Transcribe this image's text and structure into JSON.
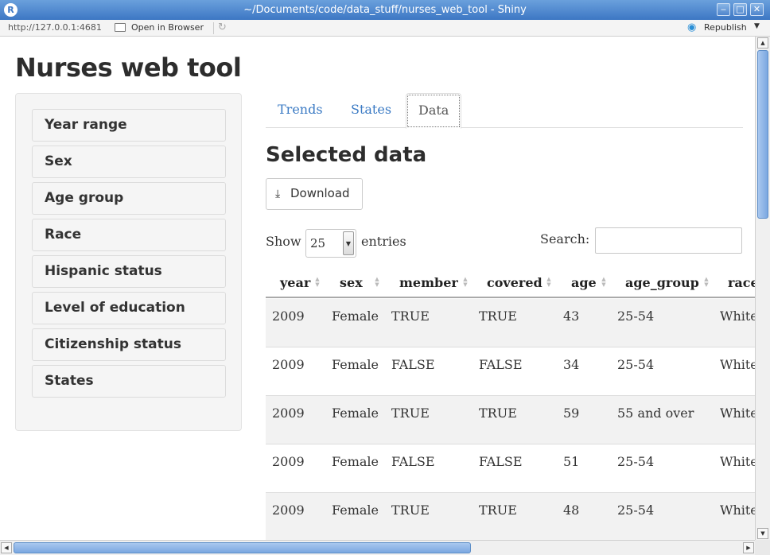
{
  "window": {
    "title": "~/Documents/code/data_stuff/nurses_web_tool - Shiny",
    "minimize_glyph": "‒",
    "maximize_glyph": "□",
    "close_glyph": "✕"
  },
  "toolbar": {
    "url": "http://127.0.0.1:4681",
    "open_in_browser": "Open in Browser",
    "republish": "Republish"
  },
  "app": {
    "title": "Nurses web tool"
  },
  "sidebar": {
    "items": [
      {
        "label": "Year range"
      },
      {
        "label": "Sex"
      },
      {
        "label": "Age group"
      },
      {
        "label": "Race"
      },
      {
        "label": "Hispanic status"
      },
      {
        "label": "Level of education"
      },
      {
        "label": "Citizenship status"
      },
      {
        "label": "States"
      }
    ]
  },
  "tabs": [
    {
      "label": "Trends",
      "active": false
    },
    {
      "label": "States",
      "active": false
    },
    {
      "label": "Data",
      "active": true
    }
  ],
  "main": {
    "section_title": "Selected data",
    "download_label": "Download",
    "show_label": "Show",
    "page_length": "25",
    "entries_label": "entries",
    "search_label": "Search:",
    "search_value": ""
  },
  "table": {
    "columns": [
      "year",
      "sex",
      "member",
      "covered",
      "age",
      "age_group",
      "race"
    ],
    "rows": [
      [
        "2009",
        "Female",
        "TRUE",
        "TRUE",
        "43",
        "25-54",
        "White"
      ],
      [
        "2009",
        "Female",
        "FALSE",
        "FALSE",
        "34",
        "25-54",
        "White"
      ],
      [
        "2009",
        "Female",
        "TRUE",
        "TRUE",
        "59",
        "55 and over",
        "White"
      ],
      [
        "2009",
        "Female",
        "FALSE",
        "FALSE",
        "51",
        "25-54",
        "White"
      ],
      [
        "2009",
        "Female",
        "TRUE",
        "TRUE",
        "48",
        "25-54",
        "White"
      ]
    ]
  }
}
